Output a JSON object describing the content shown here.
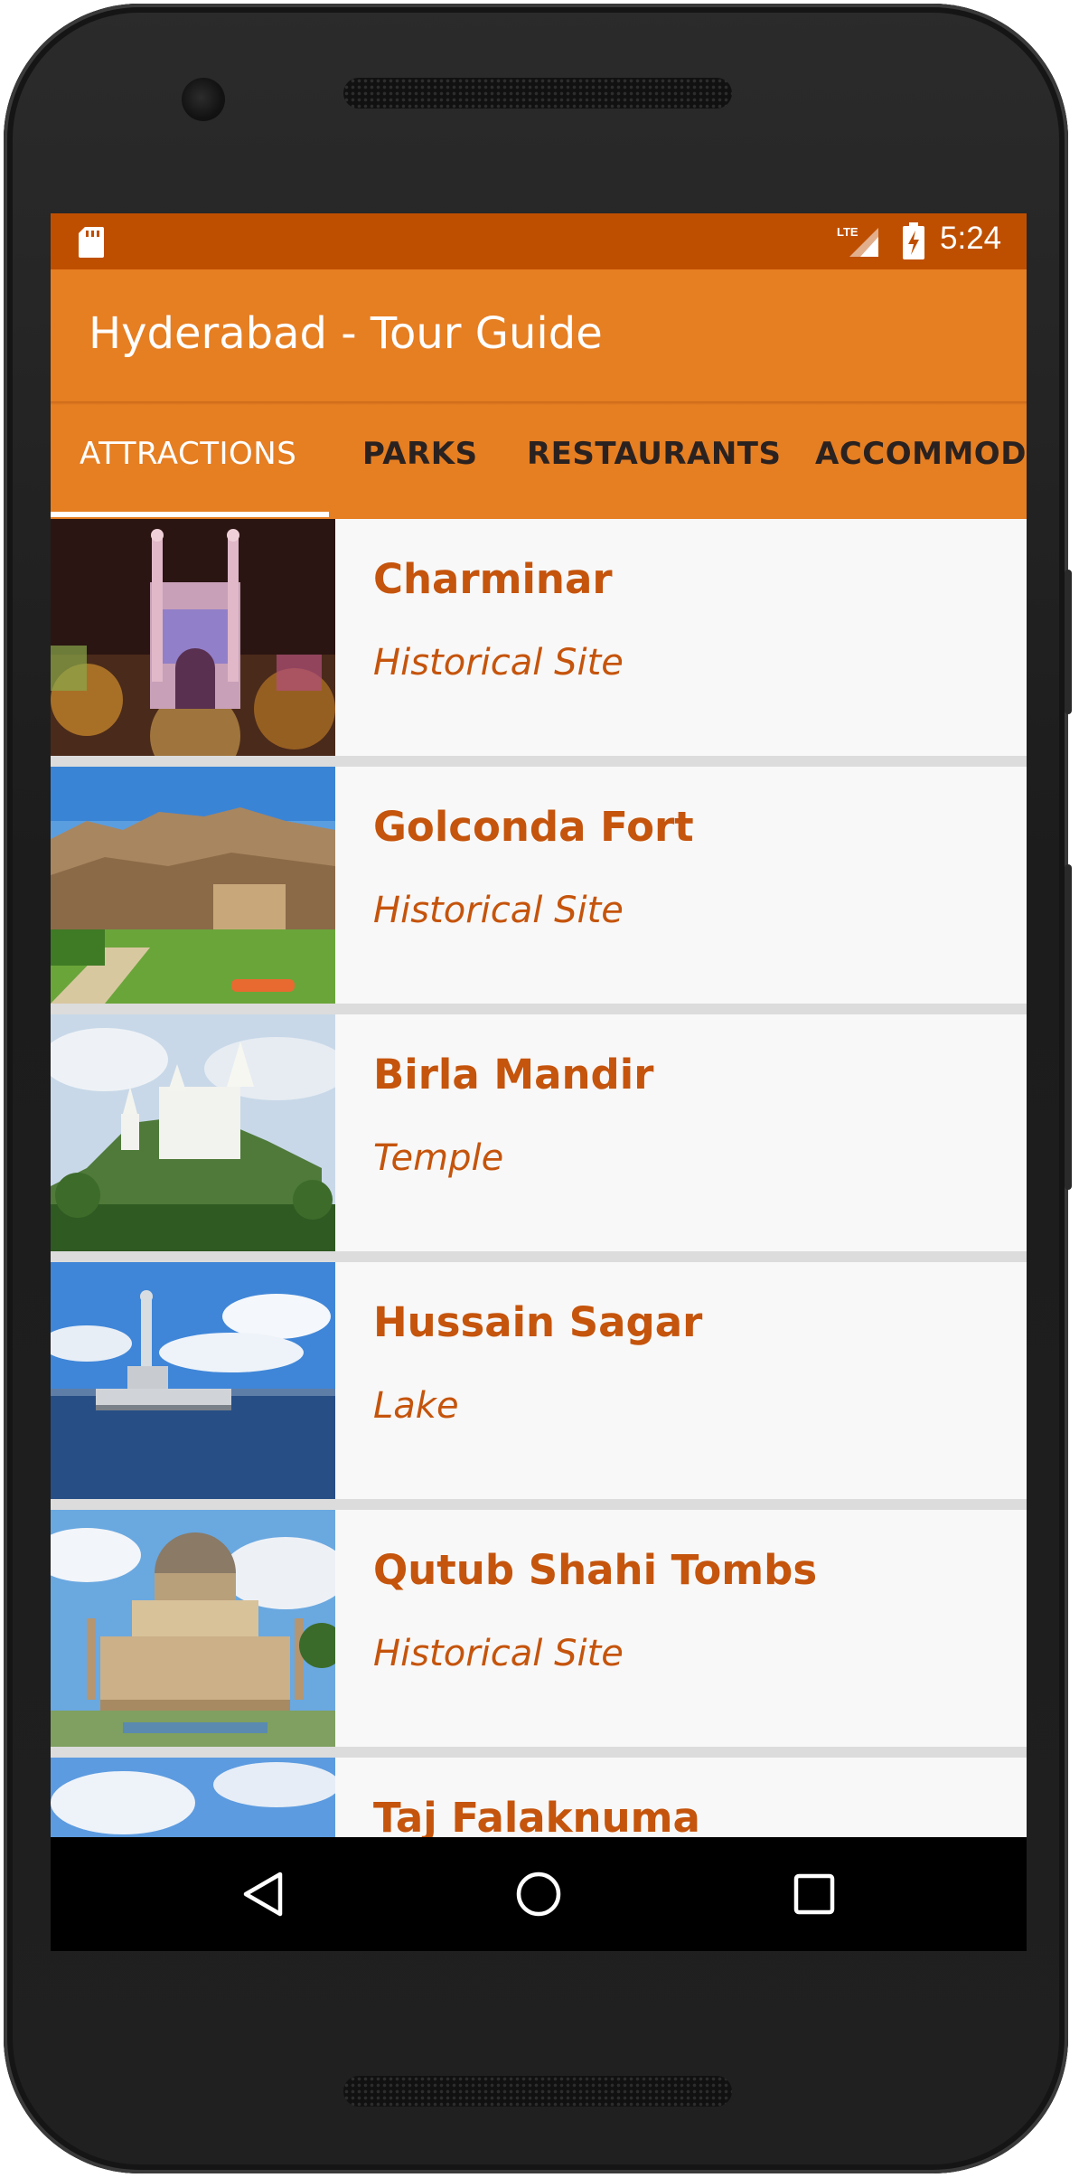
{
  "status_bar": {
    "time": "5:24",
    "network": "LTE",
    "icons": [
      "sd-card-icon",
      "lte-signal-icon",
      "battery-charging-icon"
    ]
  },
  "app_bar": {
    "title": "Hyderabad - Tour Guide"
  },
  "tabs": [
    {
      "label": "ATTRACTIONS",
      "active": true
    },
    {
      "label": "PARKS",
      "active": false
    },
    {
      "label": "RESTAURANTS",
      "active": false
    },
    {
      "label": "ACCOMMODA",
      "active": false
    }
  ],
  "places": [
    {
      "name": "Charminar",
      "category": "Historical Site"
    },
    {
      "name": "Golconda Fort",
      "category": "Historical Site"
    },
    {
      "name": "Birla Mandir",
      "category": "Temple"
    },
    {
      "name": "Hussain Sagar",
      "category": "Lake"
    },
    {
      "name": "Qutub Shahi Tombs",
      "category": "Historical Site"
    },
    {
      "name": "Taj Falaknuma",
      "category": ""
    }
  ],
  "nav": {
    "buttons": [
      "back-icon",
      "home-icon",
      "recents-icon"
    ]
  },
  "colors": {
    "status_bar": "#bf4f00",
    "primary": "#e67e22",
    "accent_text": "#c5540c",
    "tab_indicator": "#ffffff"
  }
}
